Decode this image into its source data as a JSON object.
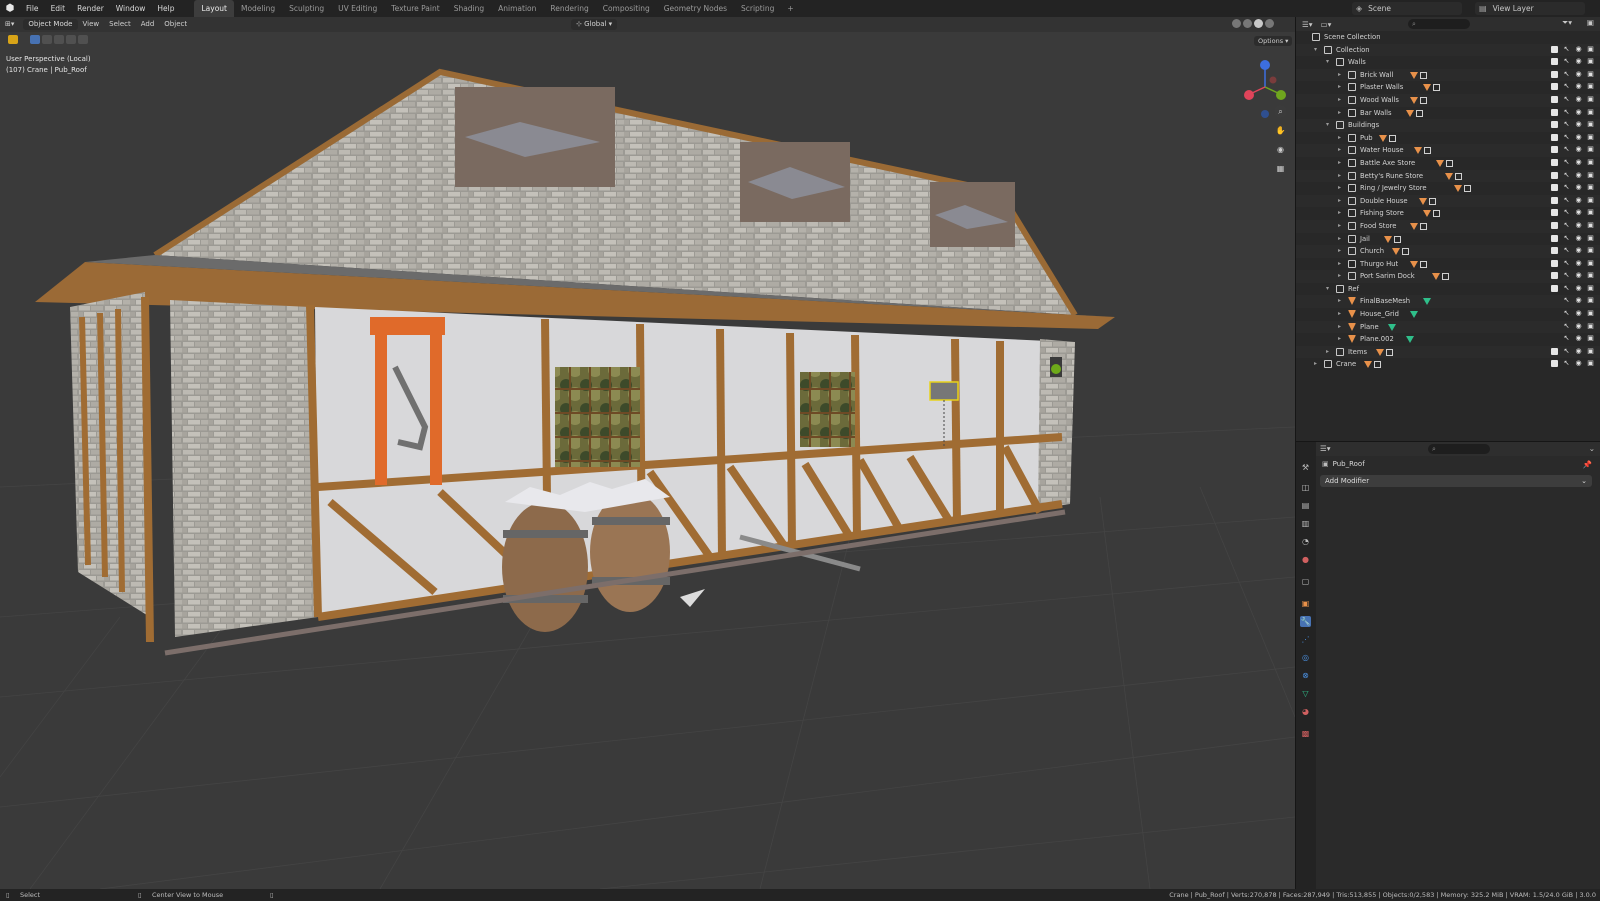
{
  "menu": [
    "File",
    "Edit",
    "Render",
    "Window",
    "Help"
  ],
  "workspaces": [
    "Layout",
    "Modeling",
    "Sculpting",
    "UV Editing",
    "Texture Paint",
    "Shading",
    "Animation",
    "Rendering",
    "Compositing",
    "Geometry Nodes",
    "Scripting"
  ],
  "workspace_add": "+",
  "active_workspace": "Layout",
  "scene_name": "Scene",
  "view_layer": "View Layer",
  "viewport": {
    "mode": "Object Mode",
    "menus": [
      "View",
      "Select",
      "Add",
      "Object"
    ],
    "transform_orientation": "Global",
    "options_label": "Options",
    "info_line1": "User Perspective (Local)",
    "info_line2": "(107) Crane | Pub_Roof"
  },
  "outliner": {
    "rows": [
      {
        "label": "Scene Collection",
        "indent": 0,
        "kind": "scene",
        "arrow": ""
      },
      {
        "label": "Collection",
        "indent": 1,
        "kind": "coll",
        "arrow": "▾"
      },
      {
        "label": "Walls",
        "indent": 2,
        "kind": "coll",
        "arrow": "▾"
      },
      {
        "label": "Brick Wall",
        "indent": 3,
        "kind": "coll",
        "arrow": "▸",
        "mesh": "orange"
      },
      {
        "label": "Plaster Walls",
        "indent": 3,
        "kind": "coll",
        "arrow": "▸",
        "mesh": "orange"
      },
      {
        "label": "Wood Walls",
        "indent": 3,
        "kind": "coll",
        "arrow": "▸",
        "mesh": "orange"
      },
      {
        "label": "Bar Walls",
        "indent": 3,
        "kind": "coll",
        "arrow": "▸",
        "mesh": "orange"
      },
      {
        "label": "Buildings",
        "indent": 2,
        "kind": "coll",
        "arrow": "▾"
      },
      {
        "label": "Pub",
        "indent": 3,
        "kind": "coll",
        "arrow": "▸",
        "mesh": "orange"
      },
      {
        "label": "Water House",
        "indent": 3,
        "kind": "coll",
        "arrow": "▸",
        "mesh": "orange"
      },
      {
        "label": "Battle Axe Store",
        "indent": 3,
        "kind": "coll",
        "arrow": "▸",
        "mesh": "orange"
      },
      {
        "label": "Betty's Rune Store",
        "indent": 3,
        "kind": "coll",
        "arrow": "▸",
        "mesh": "orange"
      },
      {
        "label": "Ring / Jewelry Store",
        "indent": 3,
        "kind": "coll",
        "arrow": "▸",
        "mesh": "orange"
      },
      {
        "label": "Double House",
        "indent": 3,
        "kind": "coll",
        "arrow": "▸",
        "mesh": "orange"
      },
      {
        "label": "Fishing Store",
        "indent": 3,
        "kind": "coll",
        "arrow": "▸",
        "mesh": "orange"
      },
      {
        "label": "Food Store",
        "indent": 3,
        "kind": "coll",
        "arrow": "▸",
        "mesh": "orange"
      },
      {
        "label": "Jail",
        "indent": 3,
        "kind": "coll",
        "arrow": "▸",
        "mesh": "orange"
      },
      {
        "label": "Church",
        "indent": 3,
        "kind": "coll",
        "arrow": "▸",
        "mesh": "orange"
      },
      {
        "label": "Thurgo Hut",
        "indent": 3,
        "kind": "coll",
        "arrow": "▸",
        "mesh": "orange"
      },
      {
        "label": "Port Sarim Dock",
        "indent": 3,
        "kind": "coll",
        "arrow": "▸",
        "mesh": "orange"
      },
      {
        "label": "Ref",
        "indent": 2,
        "kind": "coll",
        "arrow": "▾"
      },
      {
        "label": "FinalBaseMesh",
        "indent": 3,
        "kind": "obj",
        "arrow": "▸",
        "mesh": "green"
      },
      {
        "label": "House_Grid",
        "indent": 3,
        "kind": "obj",
        "arrow": "▸",
        "mesh": "green"
      },
      {
        "label": "Plane",
        "indent": 3,
        "kind": "obj",
        "arrow": "▸",
        "mesh": "green"
      },
      {
        "label": "Plane.002",
        "indent": 3,
        "kind": "obj",
        "arrow": "▸",
        "mesh": "green"
      },
      {
        "label": "Items",
        "indent": 2,
        "kind": "coll",
        "arrow": "▸",
        "mesh": "orange"
      },
      {
        "label": "Crane",
        "indent": 1,
        "kind": "coll",
        "arrow": "▸",
        "mesh": "orange"
      }
    ]
  },
  "properties": {
    "object_name": "Pub_Roof",
    "add_modifier": "Add Modifier"
  },
  "status": {
    "select": "Select",
    "center": "Center View to Mouse",
    "stats": "Crane | Pub_Roof | Verts:270,878 | Faces:287,949 | Tris:513,855 | Objects:0/2,583 | Memory: 325.2 MiB | VRAM: 1.5/24.0 GiB | 3.0.0"
  },
  "colors": {
    "accent": "#4772b3",
    "mesh_orange": "#e8914a",
    "mesh_green": "#2fbf8a",
    "viewport_bg": "#3a3a3a"
  }
}
